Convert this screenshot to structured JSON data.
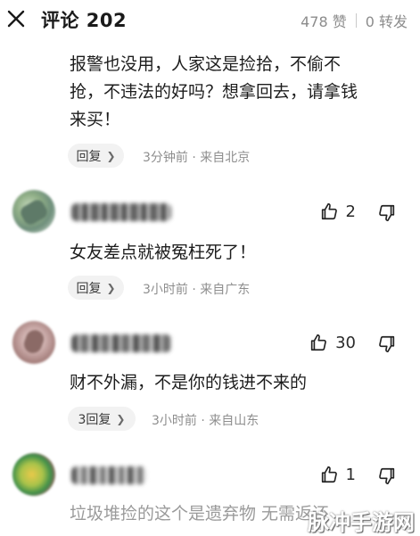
{
  "header": {
    "title": "评论 202",
    "likes": "478 赞",
    "reposts": "0 转发"
  },
  "comments": [
    {
      "text_lines": [
        "报警也没用，人家这是捡拾，不偷不",
        "抢，不违法的好吗？想拿回去，请拿钱",
        "来买！"
      ],
      "reply_label": "回复",
      "meta": "3分钟前 · 来自北京"
    },
    {
      "text_lines": [
        "女友差点就被冤枉死了！"
      ],
      "likes": "2",
      "reply_label": "回复",
      "meta": "3小时前 · 来自广东"
    },
    {
      "text_lines": [
        "财不外漏，不是你的钱进不来的"
      ],
      "likes": "30",
      "reply_label": "3回复",
      "meta": "3小时前 · 来自山东"
    },
    {
      "text_lines": [
        "垃圾堆捡的这个是遗弃物 无需返还"
      ],
      "likes": "1"
    }
  ],
  "watermark": "脉冲手游网",
  "colors": {
    "text": "#1c1c1c",
    "muted": "#8e8e8e",
    "pill_bg": "#f2f2f2"
  }
}
